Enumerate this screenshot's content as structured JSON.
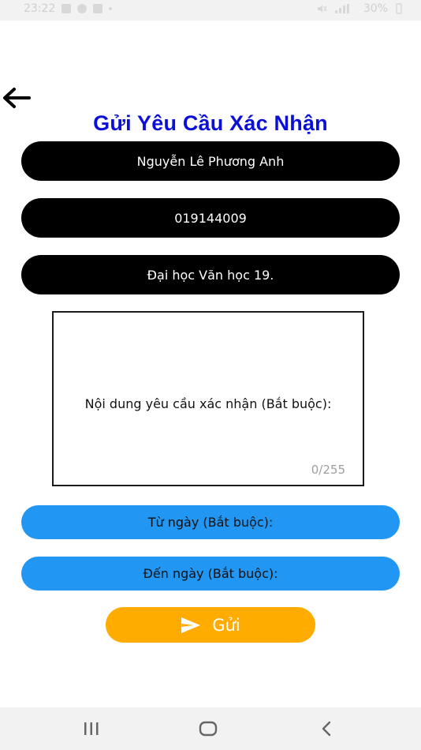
{
  "status_bar": {
    "time": "23:22",
    "battery": "30%"
  },
  "header": {
    "back_icon": "arrow-left-icon",
    "title": "Gửi Yêu Cầu Xác Nhận"
  },
  "form": {
    "name": "Nguyễn Lê Phương Anh",
    "student_id": "019144009",
    "class": "Đại học Văn học 19.",
    "content_placeholder": "Nội dung yêu cầu xác nhận (Bắt buộc):",
    "content_counter": "0/255",
    "from_date_label": "Từ ngày (Bắt buộc):",
    "to_date_label": "Đến ngày (Bắt buộc):",
    "send_label": "Gửi",
    "send_icon": "send-icon"
  },
  "colors": {
    "title": "#0b10d8",
    "field_dark": "#000000",
    "field_blue": "#2196f3",
    "send_button": "#ffab00"
  },
  "nav_bar": {
    "icons": [
      "recent-apps-icon",
      "home-icon",
      "back-icon"
    ]
  }
}
